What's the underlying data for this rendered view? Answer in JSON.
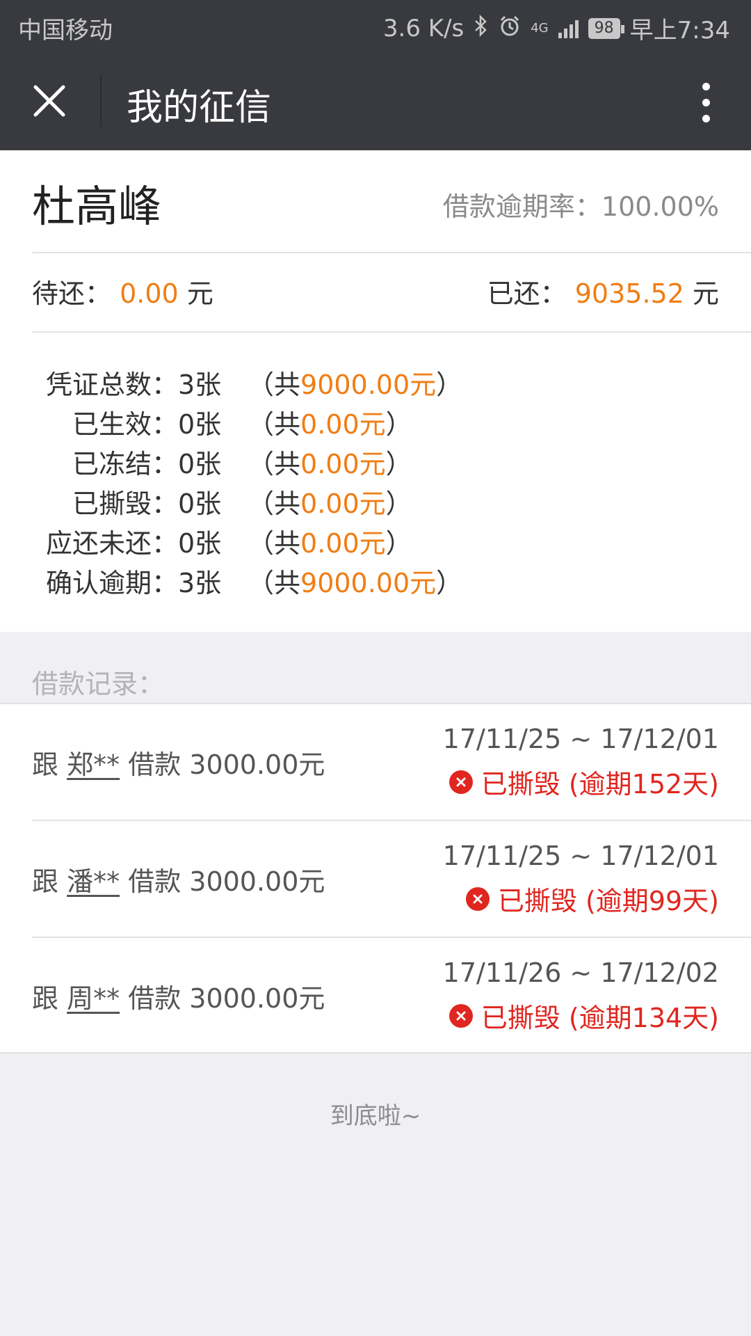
{
  "status_bar": {
    "carrier": "中国移动",
    "speed": "3.6 K/s",
    "network": "4G",
    "battery": "98",
    "time": "早上7:34"
  },
  "title_bar": {
    "title": "我的征信",
    "close_icon": "close-icon",
    "more_icon": "more-vertical-icon"
  },
  "summary": {
    "name": "杜高峰",
    "overdue_rate_label": "借款逾期率：",
    "overdue_rate_value": "100.00%",
    "pending_label": "待还：",
    "pending_amount": "0.00",
    "pending_unit": "元",
    "repaid_label": "已还：",
    "repaid_amount": "9035.52",
    "repaid_unit": "元"
  },
  "stats": [
    {
      "label": "凭证总数：",
      "count": "3张",
      "prefix": "（共 ",
      "amount": "9000.00元",
      "suffix": "）"
    },
    {
      "label": "已生效：",
      "count": "0张",
      "prefix": "（共 ",
      "amount": "0.00元",
      "suffix": "）"
    },
    {
      "label": "已冻结：",
      "count": "0张",
      "prefix": "（共 ",
      "amount": "0.00元",
      "suffix": "）"
    },
    {
      "label": "已撕毁：",
      "count": "0张",
      "prefix": "（共 ",
      "amount": "0.00元",
      "suffix": "）"
    },
    {
      "label": "应还未还：",
      "count": "0张",
      "prefix": "（共 ",
      "amount": "0.00元",
      "suffix": "）"
    },
    {
      "label": "确认逾期：",
      "count": "3张",
      "prefix": "（共 ",
      "amount": "9000.00元",
      "suffix": "）"
    }
  ],
  "records_header": "借款记录：",
  "records": [
    {
      "prefix": "跟 ",
      "lender": "郑**",
      "desc": " 借款 3000.00元",
      "date_range": "17/11/25 ~ 17/12/01",
      "status": "已撕毁 (逾期152天)"
    },
    {
      "prefix": "跟 ",
      "lender": "潘**",
      "desc": " 借款 3000.00元",
      "date_range": "17/11/25 ~ 17/12/01",
      "status": "已撕毁 (逾期99天)"
    },
    {
      "prefix": "跟 ",
      "lender": "周**",
      "desc": " 借款 3000.00元",
      "date_range": "17/11/26 ~ 17/12/02",
      "status": "已撕毁 (逾期134天)"
    }
  ],
  "footer": "到底啦~",
  "colors": {
    "header_bg": "#393a3f",
    "accent_orange": "#f07d14",
    "status_red": "#e0261f",
    "page_bg": "#efeff4"
  }
}
